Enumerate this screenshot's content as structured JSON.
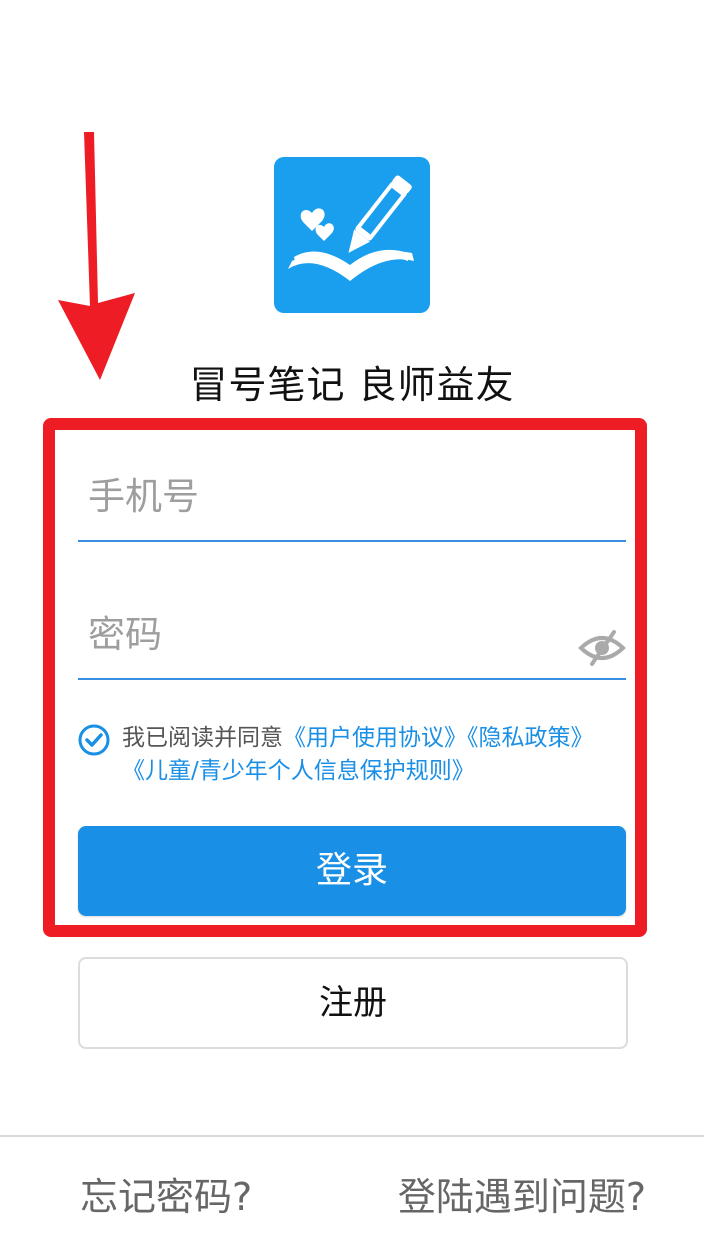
{
  "app": {
    "slogan": "冒号笔记  良师益友",
    "logo_icon": "book-pencil-icon",
    "brand_color": "#1a9fef"
  },
  "form": {
    "phone_placeholder": "手机号",
    "password_placeholder": "密码",
    "password_visibility_icon": "eye-off-icon",
    "agreement": {
      "checked": true,
      "prefix": "我已阅读并同意",
      "user_agreement": "《用户使用协议》",
      "privacy_policy": "《隐私政策》",
      "child_protection": "《儿童/青少年个人信息保护规则》"
    },
    "login_label": "登录",
    "register_label": "注册"
  },
  "footer": {
    "forgot_password": "忘记密码?",
    "login_problem": "登陆遇到问题?"
  },
  "annotation": {
    "color": "#ee1d25"
  }
}
